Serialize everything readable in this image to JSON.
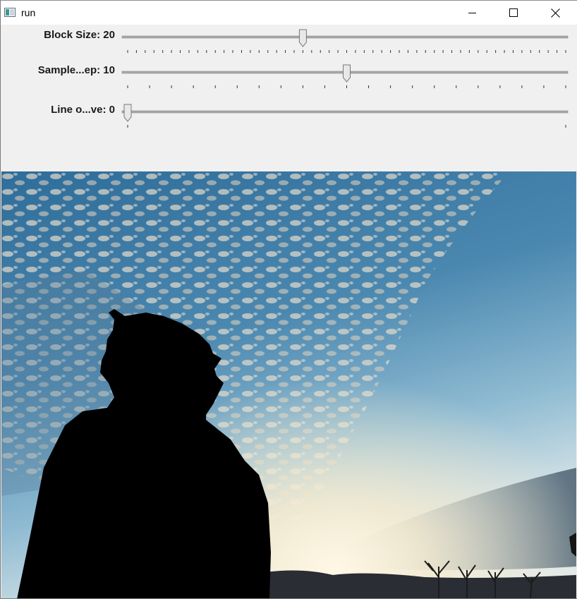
{
  "window": {
    "title": "run",
    "app_icon": "opencv-window-icon"
  },
  "caption_buttons": {
    "minimize_icon": "minimize-icon",
    "maximize_icon": "maximize-icon",
    "close_icon": "close-icon"
  },
  "trackbars": [
    {
      "label": "Block Size: 20",
      "value": 20,
      "min": 0,
      "max": 50,
      "tick_count": 50
    },
    {
      "label": "Sample...ep: 10",
      "value": 10,
      "min": 0,
      "max": 20,
      "tick_count": 20
    },
    {
      "label": "Line o...ve: 0",
      "value": 0,
      "min": 0,
      "max": 1,
      "tick_count": 1
    }
  ],
  "image": {
    "subject": "silhouette of a person against a cloudy sunset sky"
  },
  "colors": {
    "chrome": "#f0f0f0",
    "titlebar": "#ffffff",
    "track": "#9c9c9c"
  }
}
